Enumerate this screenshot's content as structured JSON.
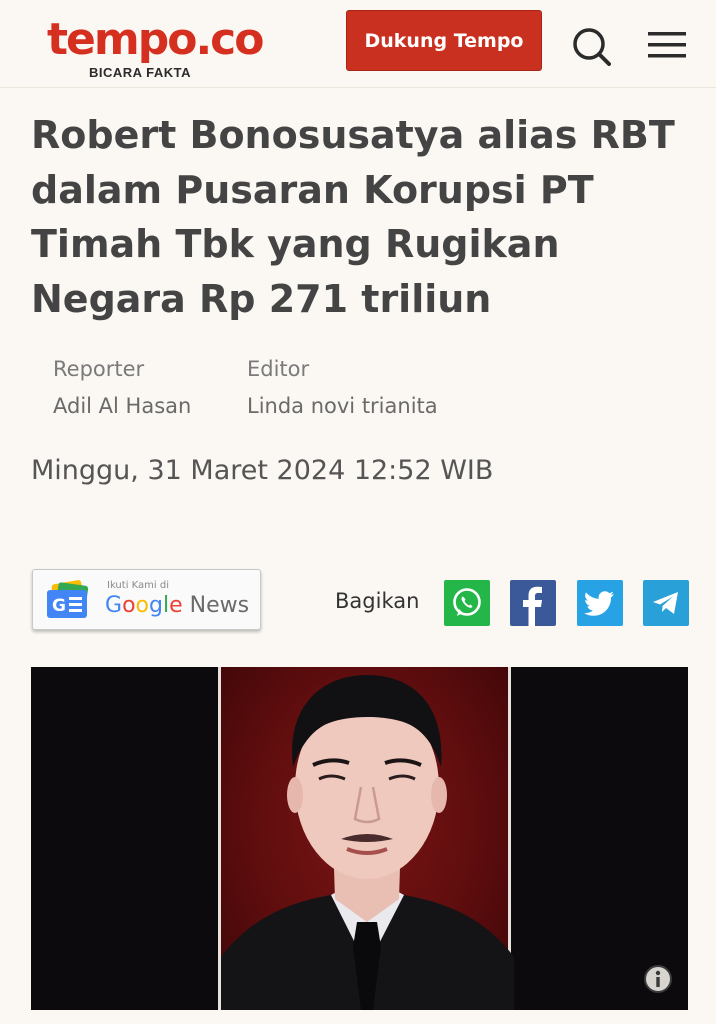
{
  "brand": {
    "logo": "tempo.co",
    "tagline": "BICARA FAKTA",
    "accent_color": "#d5301f"
  },
  "header": {
    "support_button": "Dukung Tempo",
    "search_icon": "search-icon",
    "menu_icon": "hamburger-menu-icon"
  },
  "article": {
    "title": "Robert Bonosusatya alias RBT dalam Pusaran Korupsi PT Timah Tbk yang Rugikan Negara Rp 271 triliun",
    "reporter_label": "Reporter",
    "reporter_name": "Adil Al Hasan",
    "editor_label": "Editor",
    "editor_name": "Linda novi trianita",
    "date": "Minggu, 31 Maret 2024 12:52 WIB"
  },
  "google_news": {
    "small_text": "Ikuti Kami di",
    "google_text": "Google",
    "news_text": "News"
  },
  "share": {
    "label": "Bagikan",
    "buttons": [
      {
        "name": "whatsapp-icon",
        "color": "#25b64a"
      },
      {
        "name": "facebook-icon",
        "color": "#3b5998"
      },
      {
        "name": "twitter-icon",
        "color": "#27a2e5"
      },
      {
        "name": "telegram-icon",
        "color": "#2aa0d8"
      }
    ]
  },
  "photo": {
    "info_icon": "info-icon"
  }
}
